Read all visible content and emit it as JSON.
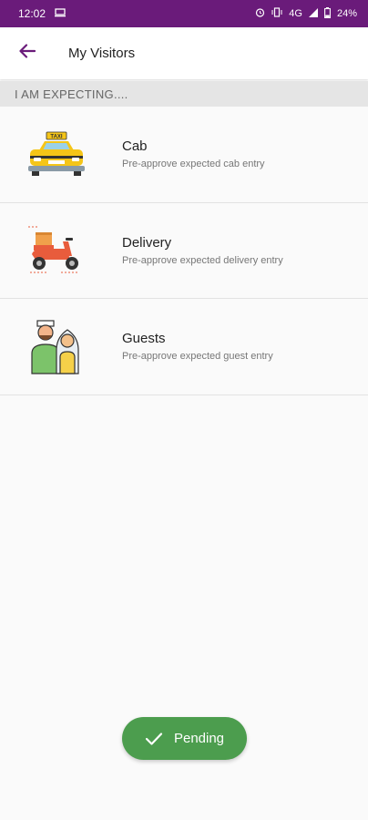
{
  "status_bar": {
    "time": "12:02",
    "network": "4G",
    "battery": "24%",
    "icons": [
      "monitor-icon",
      "alarm-icon",
      "vibrate-icon",
      "signal-icon",
      "battery-icon"
    ]
  },
  "app_bar": {
    "title": "My Visitors",
    "back_icon": "arrow-left-icon"
  },
  "section": {
    "header": "I AM EXPECTING...."
  },
  "visitor_types": [
    {
      "title": "Cab",
      "subtitle": "Pre-approve expected cab entry",
      "icon": "taxi-icon"
    },
    {
      "title": "Delivery",
      "subtitle": "Pre-approve expected delivery entry",
      "icon": "delivery-scooter-icon"
    },
    {
      "title": "Guests",
      "subtitle": "Pre-approve expected guest entry",
      "icon": "guests-icon"
    }
  ],
  "fab": {
    "label": "Pending",
    "icon": "check-icon"
  },
  "colors": {
    "status_bar": "#6a1b7a",
    "accent": "#6a1b7a",
    "fab": "#4c9d4e"
  }
}
